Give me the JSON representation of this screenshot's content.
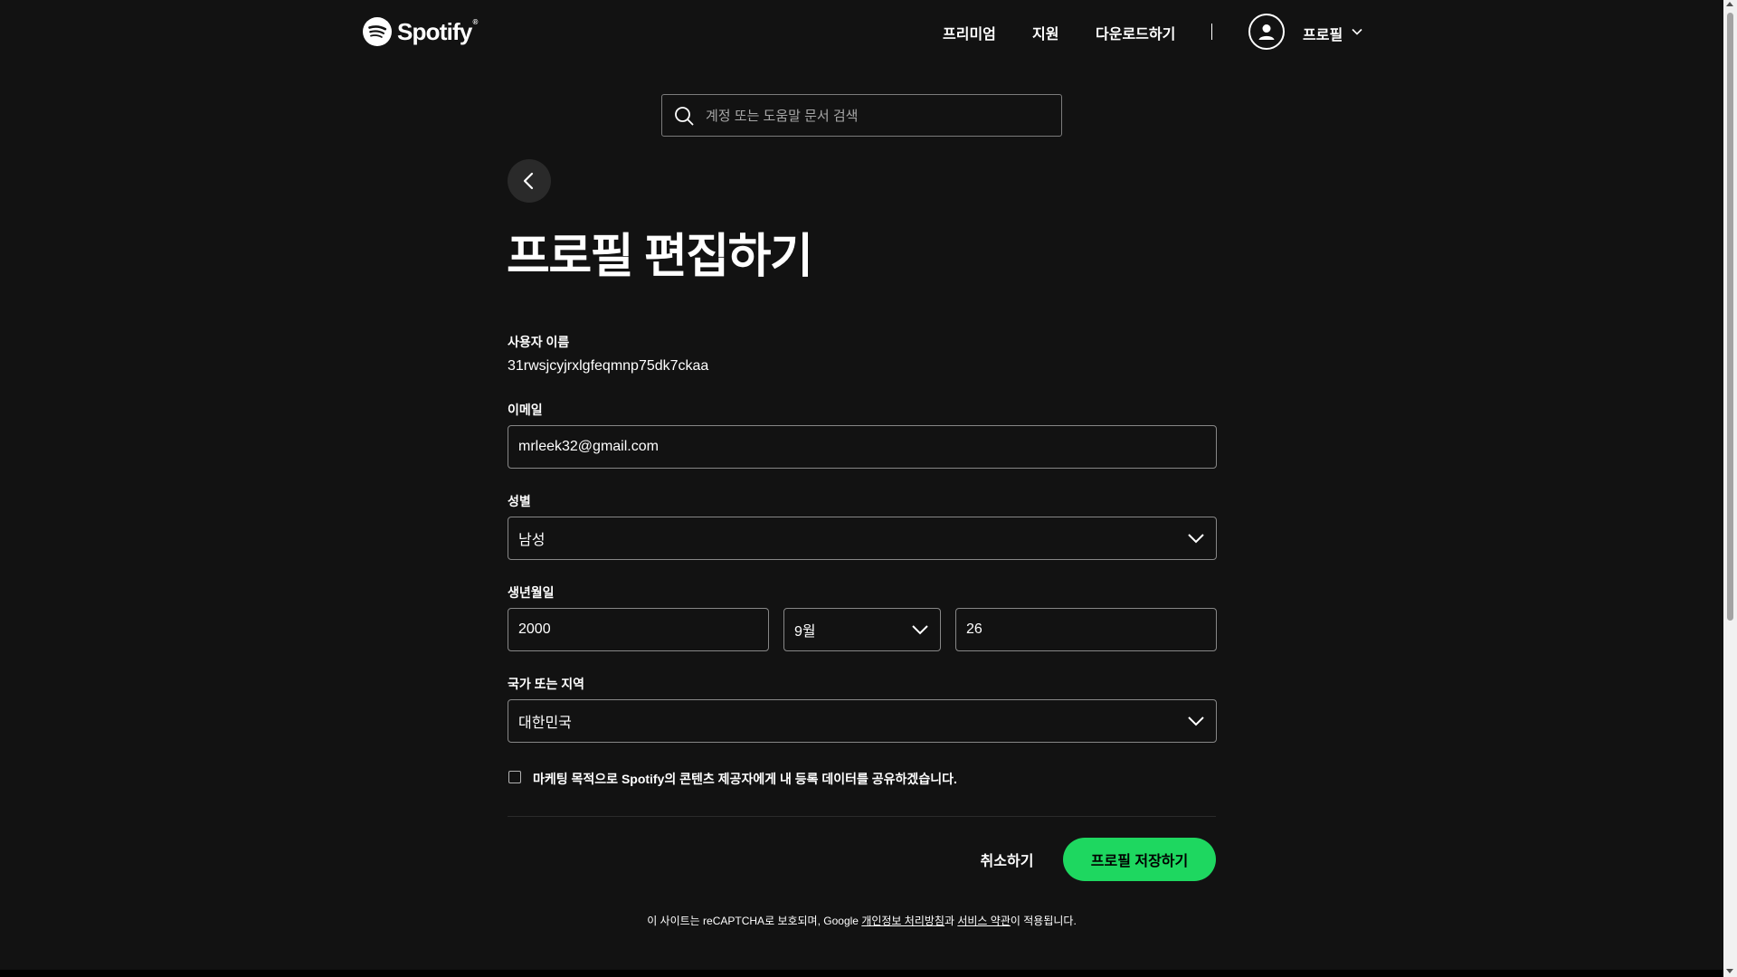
{
  "header": {
    "brand": "Spotify",
    "brand_mark": "®",
    "nav": [
      "프리미엄",
      "지원",
      "다운로드하기"
    ],
    "profile_label": "프로필"
  },
  "search": {
    "placeholder": "계정 또는 도움말 문서 검색"
  },
  "page": {
    "title": "프로필 편집하기"
  },
  "form": {
    "username_label": "사용자 이름",
    "username_value": "31rwsjcyjrxlgfeqmnp75dk7ckaa",
    "email_label": "이메일",
    "email_value": "mrleek32@gmail.com",
    "gender_label": "성별",
    "gender_value": "남성",
    "birthdate_label": "생년월일",
    "birth_year": "2000",
    "birth_month": "9월",
    "birth_day": "26",
    "country_label": "국가 또는 지역",
    "country_value": "대한민국",
    "marketing_label": "마케팅 목적으로 Spotify의 콘텐츠 제공자에게 내 등록 데이터를 공유하겠습니다."
  },
  "actions": {
    "cancel": "취소하기",
    "save": "프로필 저장하기"
  },
  "footer": {
    "prefix": "이 사이트는 reCAPTCHA로 보호되며, Google ",
    "privacy_link": "개인정보 처리방침",
    "middle": "과 ",
    "terms_link": "서비스 약관",
    "suffix": "이 적용됩니다."
  },
  "colors": {
    "background": "#121212",
    "accent": "#1ed760",
    "field_border": "#878787"
  }
}
